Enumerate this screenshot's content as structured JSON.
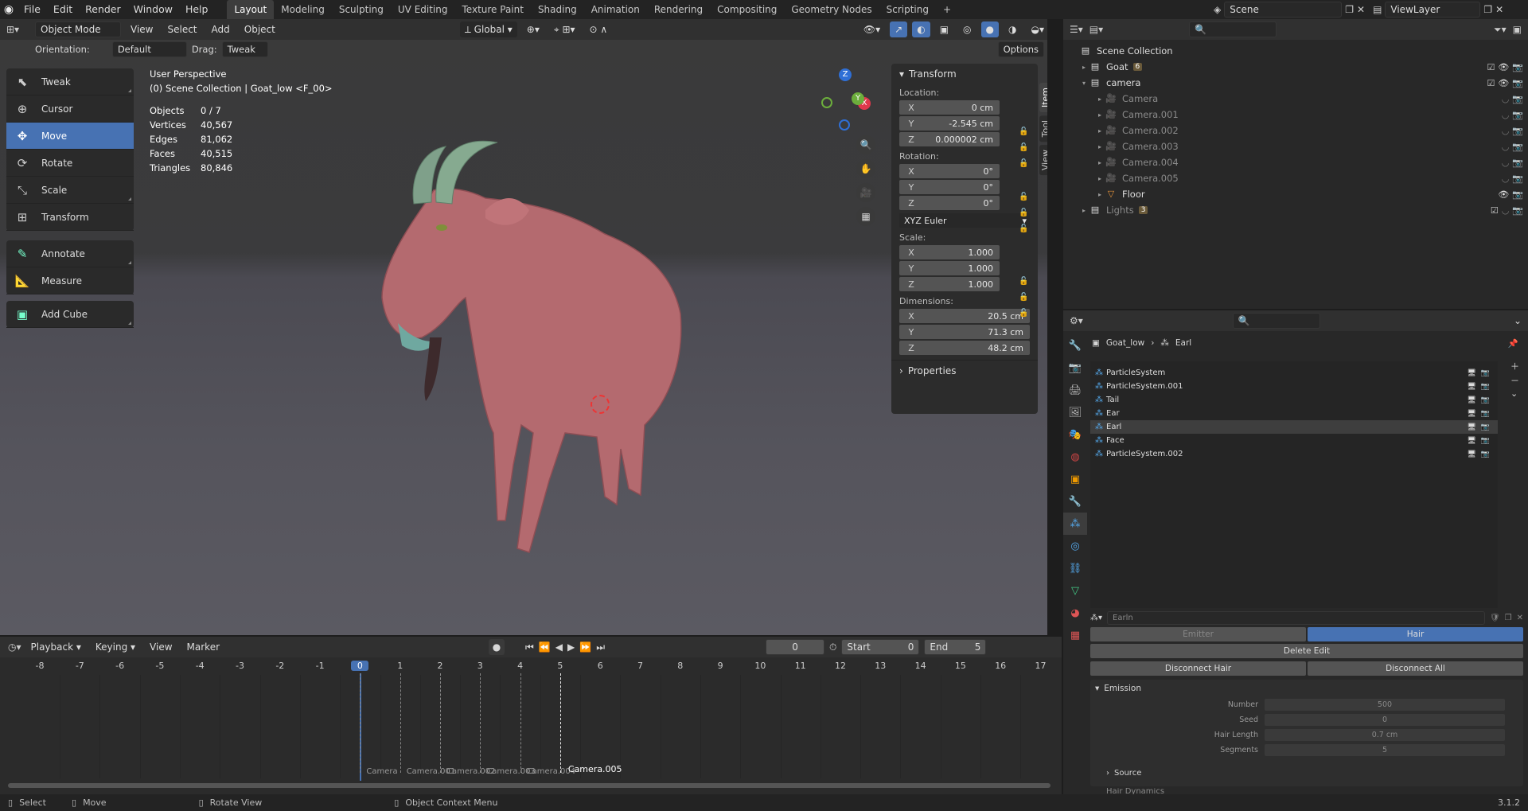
{
  "topbar": {
    "menus": [
      "File",
      "Edit",
      "Render",
      "Window",
      "Help"
    ],
    "workspaces": [
      "Layout",
      "Modeling",
      "Sculpting",
      "UV Editing",
      "Texture Paint",
      "Shading",
      "Animation",
      "Rendering",
      "Compositing",
      "Geometry Nodes",
      "Scripting"
    ],
    "active_workspace": "Layout",
    "add_workspace": "+",
    "scene": "Scene",
    "view_layer": "ViewLayer"
  },
  "viewport": {
    "mode": "Object Mode",
    "menus": [
      "View",
      "Select",
      "Add",
      "Object"
    ],
    "transform_orientation": "Global",
    "orientation_label": "Orientation:",
    "orientation_value": "Default",
    "drag_label": "Drag:",
    "drag_value": "Tweak",
    "options": "Options",
    "overlay_title": "User Perspective",
    "overlay_sub": "(0) Scene Collection | Goat_low <F_00>",
    "stats": [
      {
        "label": "Objects",
        "value": "0 / 7"
      },
      {
        "label": "Vertices",
        "value": "40,567"
      },
      {
        "label": "Edges",
        "value": "81,062"
      },
      {
        "label": "Faces",
        "value": "40,515"
      },
      {
        "label": "Triangles",
        "value": "80,846"
      }
    ],
    "tools": [
      "Tweak",
      "Cursor",
      "Move",
      "Rotate",
      "Scale",
      "Transform",
      "Annotate",
      "Measure",
      "Add Cube"
    ],
    "active_tool": "Move",
    "gizmo": {
      "x": "X",
      "y": "Y",
      "z": "Z"
    },
    "side_tabs": [
      "Item",
      "Tool",
      "View"
    ]
  },
  "npanel": {
    "title": "Transform",
    "location_label": "Location:",
    "location": [
      {
        "axis": "X",
        "value": "0 cm"
      },
      {
        "axis": "Y",
        "value": "-2.545 cm"
      },
      {
        "axis": "Z",
        "value": "0.000002 cm"
      }
    ],
    "rotation_label": "Rotation:",
    "rotation": [
      {
        "axis": "X",
        "value": "0°"
      },
      {
        "axis": "Y",
        "value": "0°"
      },
      {
        "axis": "Z",
        "value": "0°"
      }
    ],
    "rotation_mode": "XYZ Euler",
    "scale_label": "Scale:",
    "scale": [
      {
        "axis": "X",
        "value": "1.000"
      },
      {
        "axis": "Y",
        "value": "1.000"
      },
      {
        "axis": "Z",
        "value": "1.000"
      }
    ],
    "dimensions_label": "Dimensions:",
    "dimensions": [
      {
        "axis": "X",
        "value": "20.5 cm"
      },
      {
        "axis": "Y",
        "value": "71.3 cm"
      },
      {
        "axis": "Z",
        "value": "48.2 cm"
      }
    ],
    "properties": "Properties"
  },
  "outliner": {
    "root": "Scene Collection",
    "items": [
      {
        "name": "Goat",
        "badge": "6",
        "indent": 0,
        "expand": "▸"
      },
      {
        "name": "camera",
        "badge": "",
        "indent": 0,
        "expand": "▾"
      },
      {
        "name": "Camera",
        "badge": "",
        "indent": 1,
        "expand": "▸"
      },
      {
        "name": "Camera.001",
        "badge": "",
        "indent": 1,
        "expand": "▸"
      },
      {
        "name": "Camera.002",
        "badge": "",
        "indent": 1,
        "expand": "▸"
      },
      {
        "name": "Camera.003",
        "badge": "",
        "indent": 1,
        "expand": "▸"
      },
      {
        "name": "Camera.004",
        "badge": "",
        "indent": 1,
        "expand": "▸"
      },
      {
        "name": "Camera.005",
        "badge": "",
        "indent": 1,
        "expand": "▸"
      },
      {
        "name": "Floor",
        "badge": "",
        "indent": 1,
        "expand": "▸"
      },
      {
        "name": "Lights",
        "badge": "3",
        "indent": 0,
        "expand": "▸"
      }
    ]
  },
  "properties": {
    "breadcrumb_object": "Goat_low",
    "breadcrumb_sep": "›",
    "breadcrumb_item": "Earl",
    "particle_systems": [
      "ParticleSystem",
      "ParticleSystem.001",
      "Tail",
      "Ear",
      "Earl",
      "Face",
      "ParticleSystem.002"
    ],
    "selected": "Earl",
    "settings_name": "Earln",
    "type_emitter": "Emitter",
    "type_hair": "Hair",
    "delete_edit": "Delete Edit",
    "disconnect_hair": "Disconnect Hair",
    "disconnect_all": "Disconnect All",
    "emission": "Emission",
    "emission_fields": [
      {
        "label": "Number",
        "value": "500"
      },
      {
        "label": "Seed",
        "value": "0"
      },
      {
        "label": "Hair Length",
        "value": "0.7 cm"
      },
      {
        "label": "Segments",
        "value": "5"
      }
    ],
    "source": "Source",
    "hair_dynamics": "Hair Dynamics"
  },
  "timeline": {
    "menus": [
      "Playback",
      "Keying",
      "View",
      "Marker"
    ],
    "current_frame": "0",
    "start_label": "Start",
    "start": "0",
    "end_label": "End",
    "end": "5",
    "ticks": [
      "-8",
      "-7",
      "-6",
      "-5",
      "-4",
      "-3",
      "-2",
      "-1",
      "0",
      "1",
      "2",
      "3",
      "4",
      "5",
      "6",
      "7",
      "8",
      "9",
      "10",
      "11",
      "12",
      "13",
      "14",
      "15",
      "16",
      "17"
    ],
    "markers": [
      "Camera",
      "Camera.001",
      "Camera.002",
      "Camera.003",
      "Camera.004",
      "Camera.005"
    ]
  },
  "status": {
    "select": "Select",
    "move": "Move",
    "rotate": "Rotate View",
    "context": "Object Context Menu",
    "version": "3.1.2"
  },
  "colors": {
    "accent": "#4772b3",
    "goat": "#b86a6e",
    "horn": "#7fa08a"
  }
}
